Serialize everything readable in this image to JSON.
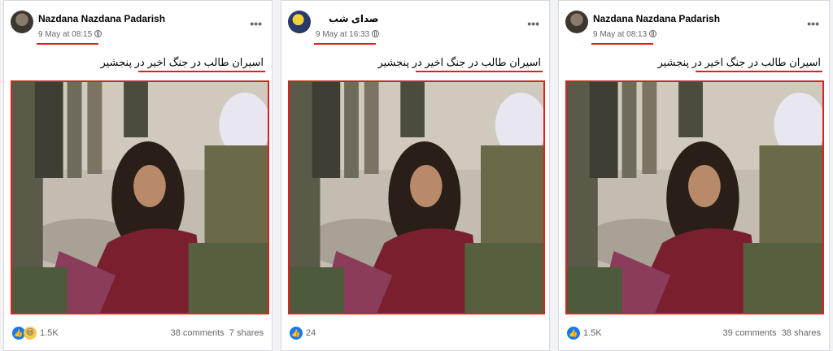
{
  "posts": [
    {
      "author": "Nazdana Nazdana Padarish",
      "timestamp": "9 May at 08:15",
      "more_label": "•••",
      "caption": "اسیران طالب در جنگ اخیر در پنجشیر",
      "reactions_count": "1.5K",
      "comments": "38 comments",
      "shares": "7 shares"
    },
    {
      "author": "صدای شب",
      "timestamp": "9 May at 16:33",
      "more_label": "•••",
      "caption": "اسیران طالب در جنگ اخیر در پنجشیر",
      "reactions_count": "24",
      "comments": "",
      "shares": ""
    },
    {
      "author": "Nazdana Nazdana Padarish",
      "timestamp": "9 May at 08:13",
      "more_label": "•••",
      "caption": "اسیران طالب در جنگ اخیر در پنجشیر",
      "reactions_count": "1.5K",
      "comments": "39 comments",
      "shares": "38 shares"
    }
  ],
  "icons": {
    "like": "like-icon",
    "haha": "haha-icon",
    "globe": "globe-icon"
  },
  "colors": {
    "highlight": "#e02020",
    "like": "#1877f2"
  }
}
